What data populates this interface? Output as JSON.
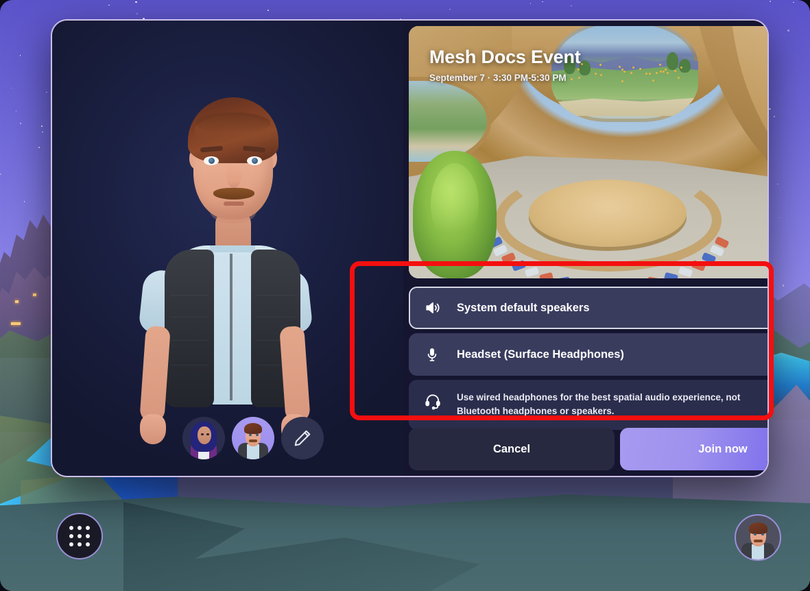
{
  "event": {
    "title": "Mesh Docs Event",
    "subtitle": "September 7 · 3:30 PM-5:30 PM"
  },
  "audio": {
    "speaker_row": {
      "label": "System default speakers",
      "icon": "speaker-icon",
      "trailing_icon": "audio-settings-sliders-icon",
      "focused": true
    },
    "microphone_row": {
      "label": "Headset (Surface Headphones)",
      "icon": "microphone-icon",
      "toggle_on": true
    },
    "note": {
      "icon": "headset-icon",
      "text": "Use wired headphones for the best spatial audio experience, not Bluetooth headphones or speakers."
    }
  },
  "actions": {
    "cancel_label": "Cancel",
    "join_label": "Join now"
  },
  "avatar_picker": {
    "items": [
      {
        "name": "avatar-option-1",
        "selected": false
      },
      {
        "name": "avatar-option-2",
        "selected": true
      }
    ],
    "edit_icon": "pencil-icon"
  },
  "taskbar": {
    "launcher_icon": "app-grid-icon",
    "me_avatar_icon": "user-avatar-icon"
  },
  "highlight": {
    "color": "#f40f0f"
  },
  "colors": {
    "dialog_bg": "#151530",
    "dialog_border": "#cdbfe8",
    "row_bg": "#3a3c5e",
    "note_bg": "#2b2d4c",
    "toggle_on": "#9b93ec",
    "join_gradient_start": "#a79af0",
    "join_gradient_end": "#6f63ea",
    "cancel_bg": "#272940",
    "accent_purple": "#9a8fd6"
  }
}
